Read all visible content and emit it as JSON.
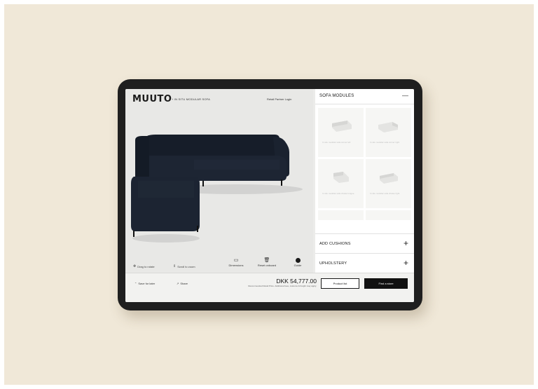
{
  "header": {
    "logo": "MUUTO",
    "product_title": "+ IN SITU MODULAR SOFA",
    "retail_link": "Retail Partner Login"
  },
  "viewer": {
    "hints": [
      {
        "icon": "hand-drag-icon",
        "label": "Drag to rotate"
      },
      {
        "icon": "scroll-icon",
        "label": "Scroll to zoom"
      }
    ],
    "tools": [
      {
        "icon": "ruler-icon",
        "label": "Dimensions"
      },
      {
        "icon": "trash-icon",
        "label": "Reset onboard"
      },
      {
        "icon": "color-dot-icon",
        "label": "Guide"
      }
    ]
  },
  "panel": {
    "modules_title": "SOFA MODULES",
    "collapse_symbol": "—",
    "cards": [
      {
        "caption": "In situ modular sofa corner left"
      },
      {
        "caption": "In situ modular sofa corner right"
      },
      {
        "caption": "In situ modular sofa chaise longue"
      },
      {
        "caption": "In situ modular sofa chaise right"
      }
    ],
    "cushions_title": "ADD CUSHIONS",
    "upholstery_title": "UPHOLSTERY",
    "expand_symbol": "+"
  },
  "footer": {
    "save_label": "Save for later",
    "share_label": "Share",
    "price": "DKK 54,777.00",
    "price_note": "Recommended Retail Price. Additional fees, customs & freight may apply.",
    "product_list_label": "Product list",
    "find_store_label": "Find a store"
  },
  "colors": {
    "background": "#f0e8d8",
    "tablet_bezel": "#1f1f1f",
    "sofa": "#1b2330",
    "accent": "#111111"
  }
}
